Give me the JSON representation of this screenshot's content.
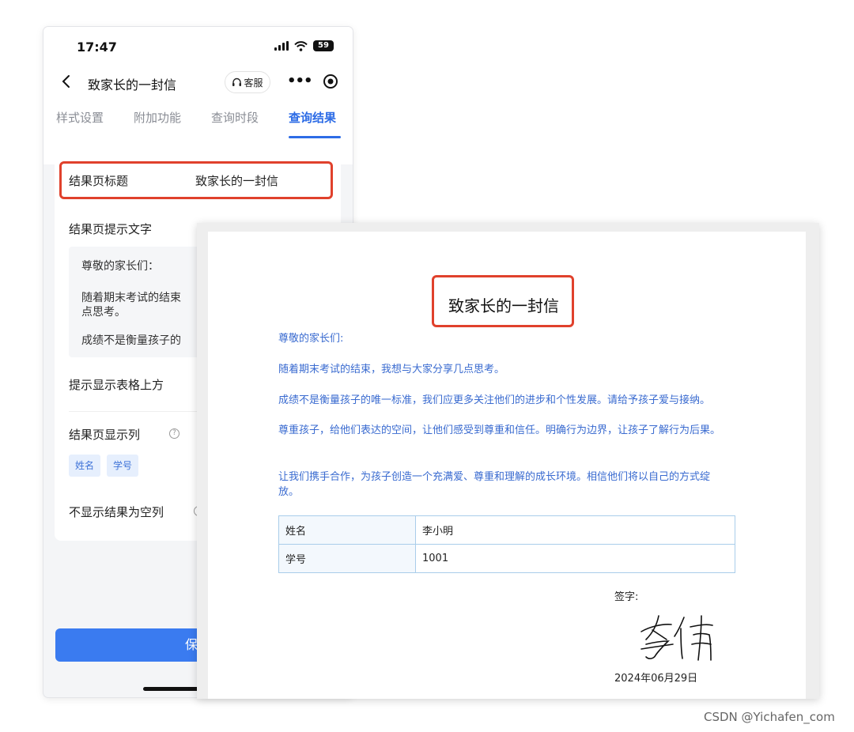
{
  "phone": {
    "status": {
      "time": "17:47",
      "battery": "59"
    },
    "nav": {
      "title": "致家长的一封信",
      "kefu_label": "客服",
      "more_label": "•••"
    },
    "tabs": [
      {
        "label": "样式设置"
      },
      {
        "label": "附加功能"
      },
      {
        "label": "查询时段"
      },
      {
        "label": "查询结果",
        "active": true
      }
    ],
    "form": {
      "result_title_label": "结果页标题",
      "result_title_value": "致家长的一封信",
      "hint_label": "结果页提示文字",
      "hint_lines": [
        "尊敬的家长们：",
        "随着期末考试的结束",
        "点思考。",
        "成绩不是衡量孩子的"
      ],
      "hint_above_table_label": "提示显示表格上方",
      "columns_label": "结果页显示列",
      "column_chips": [
        "姓名",
        "学号"
      ],
      "empty_label": "不显示结果为空列"
    },
    "save_label": "保"
  },
  "letter": {
    "title": "致家长的一封信",
    "paragraphs": [
      "尊敬的家长们:",
      "随着期末考试的结束，我想与大家分享几点思考。",
      "成绩不是衡量孩子的唯一标准，我们应更多关注他们的进步和个性发展。请给予孩子爱与接纳。",
      "尊重孩子，给他们表达的空间，让他们感受到尊重和信任。明确行为边界，让孩子了解行为后果。",
      "让我们携手合作，为孩子创造一个充满爱、尊重和理解的成长环境。相信他们将以自己的方式绽放。"
    ],
    "table": [
      {
        "key": "姓名",
        "value": "李小明"
      },
      {
        "key": "学号",
        "value": "1001"
      }
    ],
    "sign_label": "签字:",
    "signature": "李伟",
    "date": "2024年06月29日"
  },
  "watermark": "CSDN @Yichafen_com",
  "colors": {
    "accent": "#2d6ce6",
    "highlight": "#e0412c",
    "letter_text": "#3a6bd0"
  }
}
